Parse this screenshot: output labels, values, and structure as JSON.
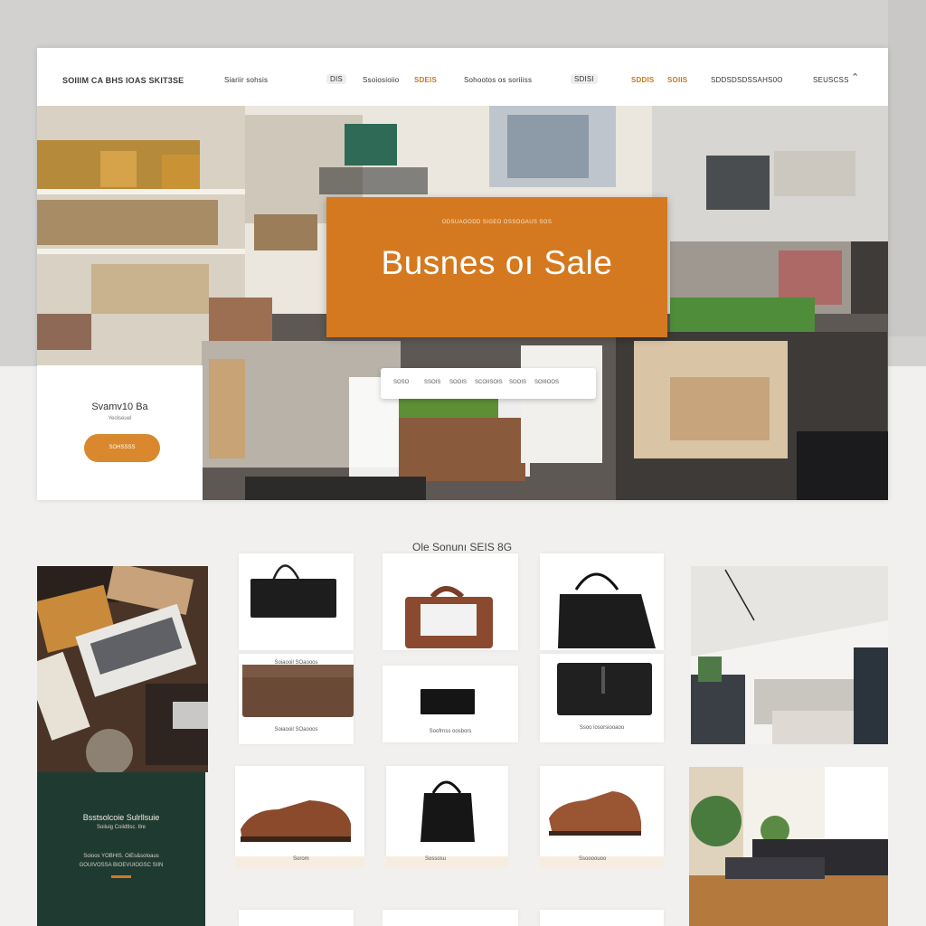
{
  "nav": {
    "brand": "SOIIIM CA BHS IOAS SKIT3SE",
    "items": [
      "Siariir sohsis",
      "Ssoiosioiio",
      "SDEIS",
      "Sohootos os soriiiss",
      "SDDIS",
      "SOIIS",
      "SDDSDSDS",
      "SAHS0O",
      "SEUSCSS"
    ],
    "pill_items": [
      "DIS",
      "SDISI"
    ],
    "user_icon": "user-icon"
  },
  "hero": {
    "eyebrow": "ODSUAOODD SIGEO  OSSOOAUS  SOS",
    "title": "Busnes oı Sale",
    "search_chips": [
      "SOSO",
      "SSOIS",
      "SOOIS",
      "SCOIISOIS",
      "SOOIS",
      "SOIIIOOS"
    ]
  },
  "hero_card": {
    "title": "Svamv10 Ba",
    "subtitle": "Yeolseuel",
    "button_label": "SOHSSSS"
  },
  "section": {
    "title": "Ole Sonunı SEIS 8G"
  },
  "products": {
    "captions": [
      "Soiaooil SOaooos",
      "Soofrnss oosbors",
      "Ssoo iosorsiooaoo"
    ]
  },
  "bottom_labels": [
    "Sorom",
    "Sossosu",
    "Ssoooouoo"
  ],
  "promo": {
    "title": "Bsstsolcoie Sulrllsuie",
    "subtitle": "Soiiuig Coiidtlsc. tlre",
    "lines": [
      "Soioos YOBHIS. OiEs&soloaus",
      "GOUIVOSSA BIOEVUIOGSC SIIN"
    ]
  },
  "colors": {
    "accent": "#d4791f",
    "cta": "#d9882d",
    "promo_bg": "#1f3a31",
    "page_bg": "#f1f0ee"
  }
}
